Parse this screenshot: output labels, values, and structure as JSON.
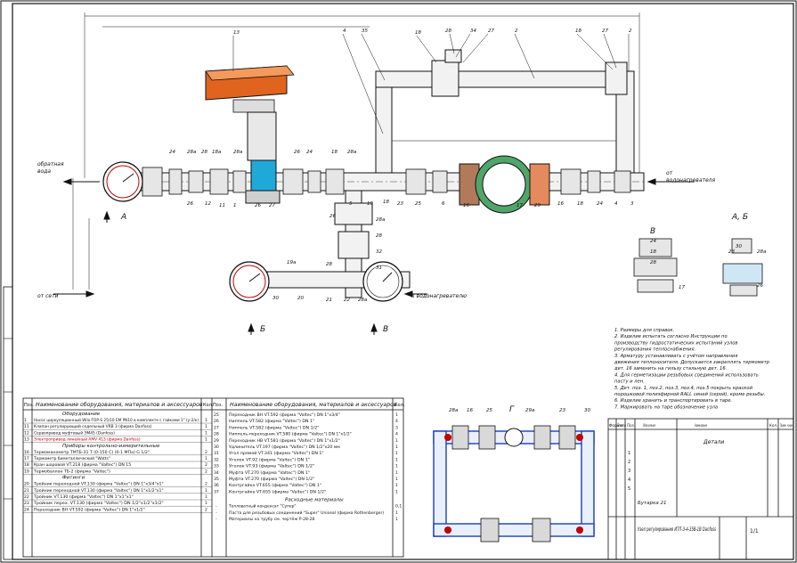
{
  "drawing": {
    "labels": {
      "return": "обратная\nвода",
      "from_boiler": "от\nводонагревателя",
      "from_network": "от сети",
      "to_heater": "к водонагревателю",
      "view_a": "А",
      "view_b": "Б",
      "view_v": "В",
      "view_ab": "А, Б",
      "view_g": "Г"
    },
    "callouts": [
      "13",
      "4",
      "35",
      "18",
      "28",
      "34",
      "27",
      "2",
      "18",
      "27",
      "2",
      "24",
      "28a",
      "28",
      "18a",
      "28a",
      "26",
      "24",
      "18",
      "28a",
      "26",
      "12",
      "11",
      "1",
      "26",
      "27",
      "5",
      "19",
      "18",
      "23",
      "25",
      "6",
      "16",
      "17",
      "29",
      "16",
      "18",
      "24",
      "4",
      "3",
      "26",
      "28a",
      "28",
      "32",
      "31",
      "28",
      "19a",
      "20",
      "21",
      "22",
      "28a",
      "30",
      "18",
      "24",
      "28",
      "17",
      "23",
      "30",
      "28a",
      "26",
      "28a",
      "16",
      "25",
      "29a",
      "23",
      "30"
    ],
    "notes": [
      "1. Размеры для справок.",
      "2. Изделие испытать согласно Инструкции по",
      "производству гидростатических испытаний узлов",
      "регулирования теплоснабжения.",
      "3. Арматуру устанавливать с учётом направления",
      "движения теплоносителя. Допускается закреплять термометр",
      "дет. 16 заменить на гильзу стальную дет. 16.",
      "4. Для герметизации резьбовых соединений использовать",
      "пасту и лен.",
      "5. Дет. поз. 1, поз.2, поз.3, поз.4, поз.5 покрыть краской",
      "порошковой полиэфирной RALL синей (серой), кроме резьбы.",
      "6. Изделие хранить и транспортировать в таре.",
      "7. Маркировать на таре обозначение узла"
    ]
  },
  "bom_left": {
    "header": [
      "Поз.",
      "Наименование оборудования, материалов и аксессуаров",
      "Кол."
    ],
    "sections": [
      {
        "title": "Оборудование",
        "rows": [
          [
            "1",
            "Насос циркуляционный Wilo-TOP-S 25/10 EM PN10 в комплекте с гайками 1\" (у-2/к)",
            "1"
          ],
          [
            "11",
            "Клапан регулирующий седельный VRB 3 (фирма Danfoss)",
            "1"
          ],
          [
            "12",
            "Сервопривод муфтовый ЭМ45 (Danfoss)",
            "1"
          ],
          [
            "13",
            "Электропривод линейный AMV 413 (фирма Danfoss)",
            "1"
          ]
        ]
      },
      {
        "title": "Приборы контрольно-измерительные",
        "rows": [
          [
            "16",
            "Термоманометр ТМТБ-31 Т (0-150 С) (0-1 МПа) G 1/2\"",
            "2"
          ],
          [
            "17",
            "Термометр биметаллический \"Watts\"",
            "1"
          ],
          [
            "18",
            "Кран шаровой VT.218 (фирма \"Valtec\") DN 15",
            "2"
          ],
          [
            "19",
            "Термобаллон ТБ-2 (фирма \"Valtec\")",
            "2"
          ]
        ]
      },
      {
        "title": "Фитинги",
        "rows": [
          [
            "20",
            "Тройник переходной VT.130 (фирма \"Valtec\") DN 1\"х3/4\"х1\"",
            "2"
          ],
          [
            "21",
            "Тройник переходной VT.130 (фирма \"Valtec\") DN 1\"х1/2\"х1\"",
            "1"
          ],
          [
            "22",
            "Тройник VT.130 (фирма \"Valtec\") DN 1\"х1\"х1\"",
            "1"
          ],
          [
            "23",
            "Тройник перех. VT.130 (фирма \"Valtec\") DN 1/2\"х1/2\"х1/2\"",
            "1"
          ],
          [
            "24",
            "Переходник ВН VT.592 (фирма \"Valtec\") DN 1\"х1/2\"",
            "2"
          ]
        ]
      }
    ]
  },
  "bom_right": {
    "header": [
      "Поз.",
      "Наименование оборудования, материалов и аксессуаров",
      "Кол."
    ],
    "rows": [
      [
        "25",
        "Переходник ВН VT.592 (фирма \"Valtec\") DN 1\"х3/4\"",
        "1"
      ],
      [
        "26",
        "Ниппель VT.582 (фирма \"Valtec\") DN 1\"",
        "4"
      ],
      [
        "27",
        "Ниппель VT.582 (фирма \"Valtec\") DN 1/2\"",
        "3"
      ],
      [
        "28",
        "Ниппель-переходник VT.580 (фирма \"Valtec\") DN 1\"х1/2\"",
        "4"
      ],
      [
        "29",
        "Переходник НВ VT.581 (фирма \"Valtec\") DN 1\"х1/2\"",
        "1"
      ],
      [
        "30",
        "Удлинитель VT.197 (фирма \"Valtec\") DN 1/2\"х20 мм",
        "1"
      ],
      [
        "31",
        "Угол прямой VT.341 (фирма \"Valtec\") DN 1\"",
        "1"
      ],
      [
        "32",
        "Уголок VT.92 (фирма \"Valtec\") DN 1\"",
        "1"
      ],
      [
        "33",
        "Уголок VT.93 (фирма \"Valtec\") DN 1/2\"",
        "1"
      ],
      [
        "34",
        "Муфта VT.270 (фирма \"Valtec\") DN 1\"",
        "1"
      ],
      [
        "35",
        "Муфта VT.270 (фирма \"Valtec\") DN 1/2\"",
        "1"
      ],
      [
        "36",
        "Контргайка VT.655 (фирма \"Valtec\") DN 1\"",
        "1"
      ],
      [
        "37",
        "Контргайка VT.655 (фирма \"Valtec\") DN 1/2\"",
        "1"
      ]
    ],
    "materials_title": "Расходные материалы",
    "materials": [
      [
        "-",
        "Тепловатный конденсат \"Супер\"",
        "0,1"
      ],
      [
        "-",
        "Паста для резьбовых соединений \"Super\" Uniseal (фирма Rothenberger)",
        "1"
      ],
      [
        "-",
        "Материалы на трубу см. чертёж P-28-28",
        "1"
      ]
    ]
  },
  "title_block": {
    "headers": [
      "Формат",
      "Зона",
      "Поз.",
      "Обозначение",
      "Наименование",
      "Кол.",
      "Приме- чание"
    ],
    "section": "Детали",
    "details": [
      "1",
      "2",
      "3",
      "4",
      "5"
    ],
    "bottom": "Бутарка 21",
    "name": "Узел регулирования ИТП-3-4-35В-1В Danfoss",
    "sheet": "1/1"
  }
}
